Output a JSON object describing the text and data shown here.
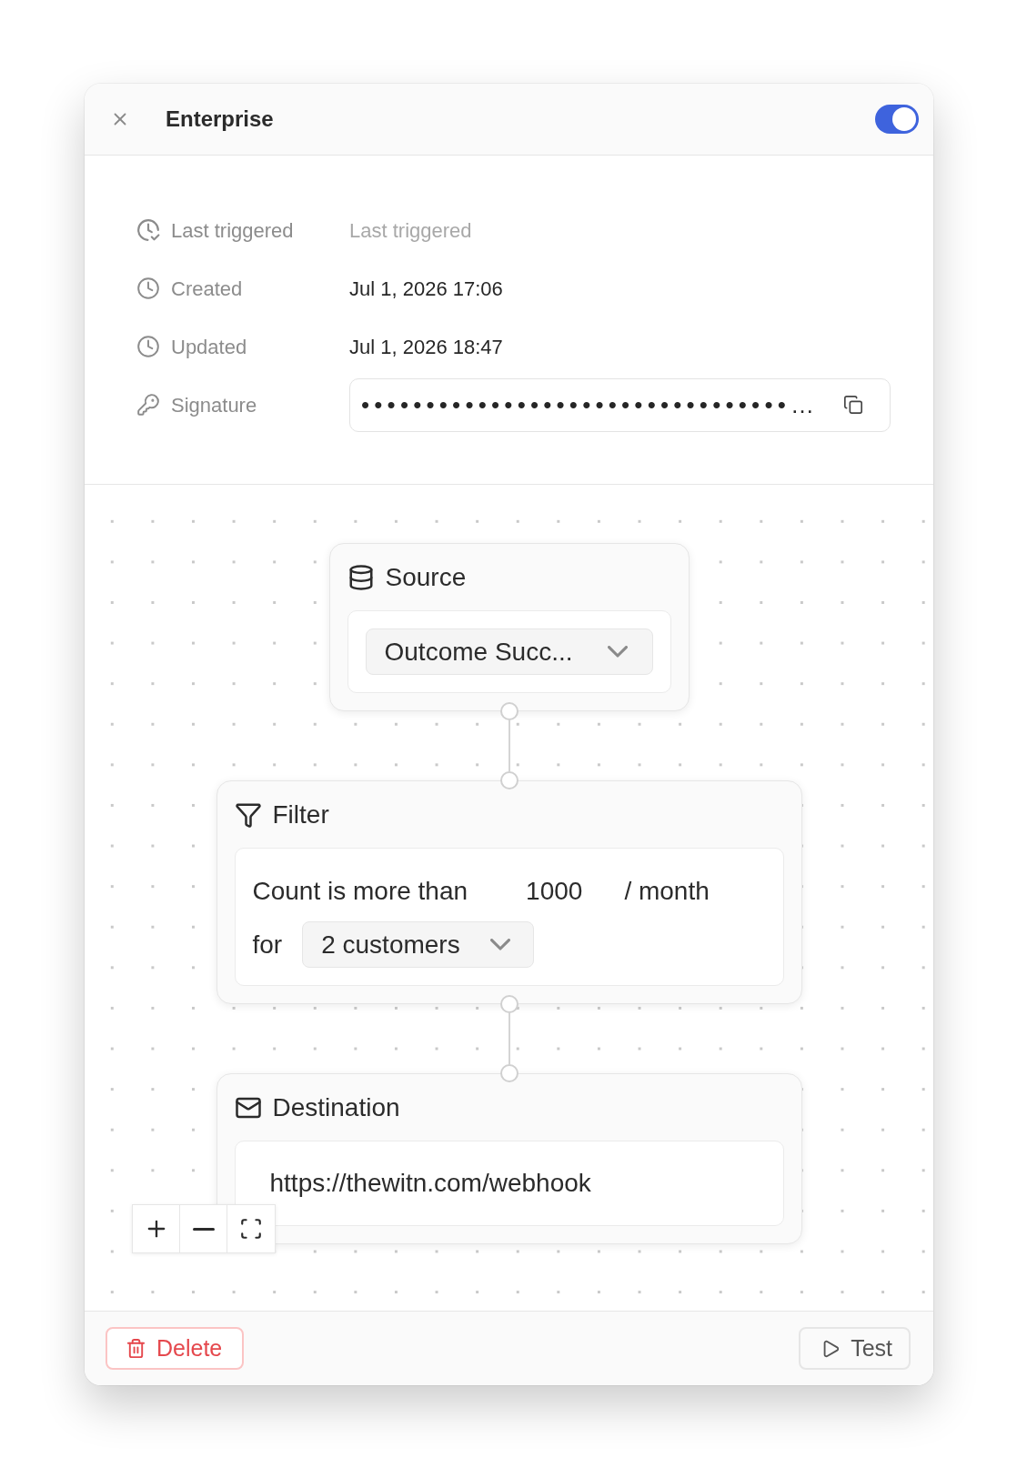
{
  "header": {
    "title": "Enterprise",
    "enabled": true
  },
  "details": [
    {
      "kind": "triggered",
      "label": "Last triggered",
      "value": "Last triggered",
      "empty": true
    },
    {
      "kind": "created",
      "label": "Created",
      "value": "Jul 1, 2026 17:06",
      "empty": false
    },
    {
      "kind": "updated",
      "label": "Updated",
      "value": "Jul 1, 2026 18:47",
      "empty": false
    },
    {
      "kind": "signature",
      "label": "Signature",
      "value": "•••••••••••••••••••••••••••••••••…"
    }
  ],
  "nodes": [
    {
      "kind": "source",
      "title": "Source",
      "select": "Outcome Succ..."
    },
    {
      "kind": "filter",
      "title": "Filter",
      "condition": "Count is more than",
      "threshold": "1000",
      "period": "/ month",
      "scope_label": "for",
      "scope_select": "2 customers"
    },
    {
      "kind": "destination",
      "title": "Destination",
      "url": "https://thewitn.com/webhook"
    }
  ],
  "footer": {
    "buttons": [
      {
        "kind": "delete",
        "label": "Delete"
      },
      {
        "kind": "test",
        "label": "Test"
      }
    ]
  }
}
